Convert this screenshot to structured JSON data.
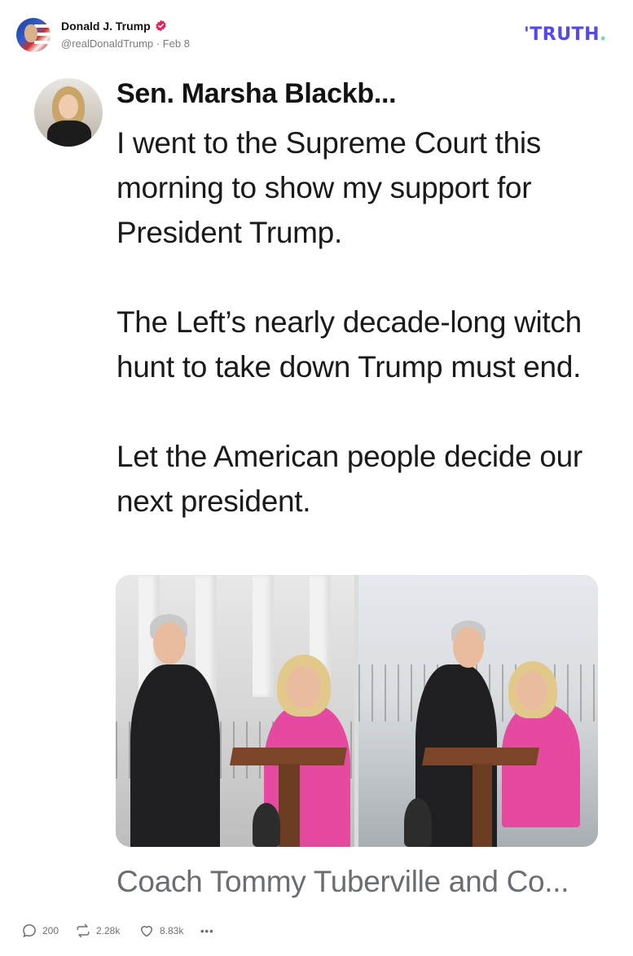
{
  "post": {
    "author_name": "Donald J. Trump",
    "handle_date": "@realDonaldTrump · Feb 8",
    "brand": "TRUTH"
  },
  "embedded": {
    "author": "Sen. Marsha Blackb...",
    "paragraphs": [
      "I went to the Supreme Court this morning to show my support for President Trump.",
      "The Left’s nearly decade-long witch hunt to take down Trump must end.",
      "Let the American people decide our next president."
    ],
    "caption": "Coach Tommy Tuberville and Co..."
  },
  "actions": {
    "replies": "200",
    "retruths": "2.28k",
    "likes": "8.83k",
    "more": "•••"
  },
  "colors": {
    "brand": "#5448ee",
    "brand_dot": "#5de5b0",
    "verified": "#e0245e",
    "muted": "#7a7a85"
  },
  "icons": [
    "verified-badge-icon",
    "reply-icon",
    "retruth-icon",
    "like-icon",
    "more-icon"
  ]
}
